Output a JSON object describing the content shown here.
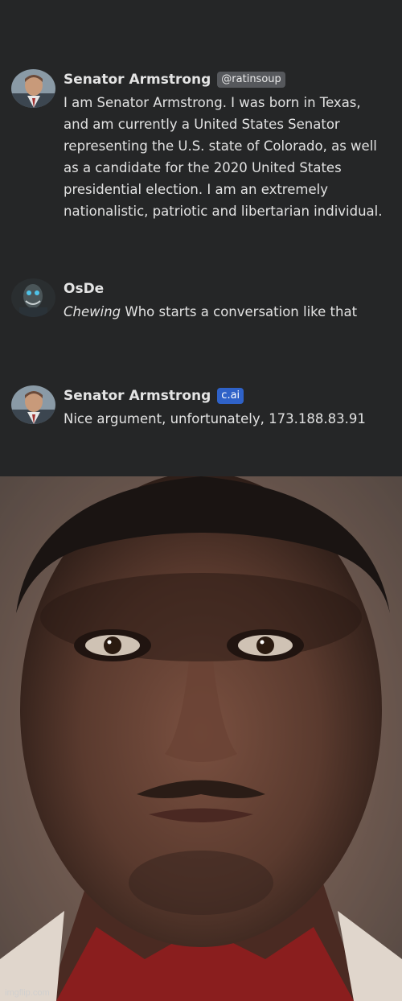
{
  "messages": [
    {
      "author": "Senator Armstrong",
      "badge": "@ratinsoup",
      "text": "I am Senator Armstrong. I was born in Texas, and am currently a United States Senator representing the U.S. state of Colorado, as well as a candidate for the 2020 United States presidential election. I am an extremely nationalistic, patriotic and libertarian individual."
    },
    {
      "author": "OsDe",
      "action": "Chewing",
      "text": " Who starts a conversation like that"
    },
    {
      "author": "Senator Armstrong",
      "badge": "c.ai",
      "text": "Nice argument, unfortunately, 173.188.83.91"
    }
  ],
  "watermark": "imgflip.com",
  "colors": {
    "chat_background": "#252627",
    "badge_handle": "#56585c",
    "badge_cai": "#2f62c8",
    "text": "#e2e2e2"
  }
}
